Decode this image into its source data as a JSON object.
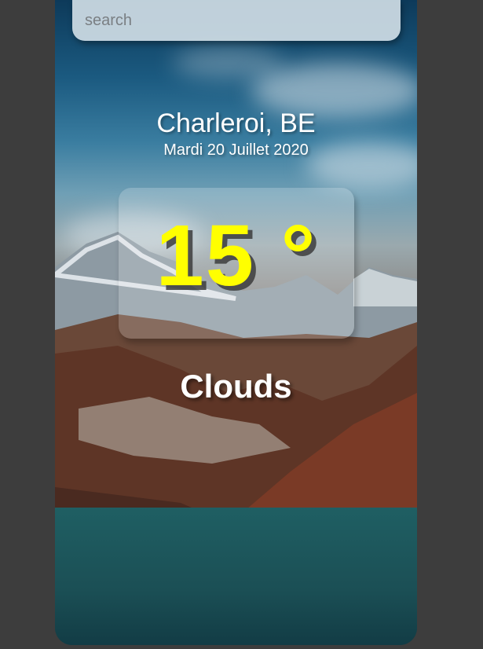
{
  "search": {
    "placeholder": "search",
    "value": ""
  },
  "location": {
    "city_country": "Charleroi, BE",
    "date": "Mardi 20 Juillet 2020"
  },
  "weather": {
    "temperature": "15 °",
    "condition": "Clouds"
  },
  "colors": {
    "page_background": "#3d3d3d",
    "temperature_text": "#ffff00",
    "text": "#ffffff",
    "search_background": "#cddce4"
  },
  "background": {
    "subject": "mountain landscape with lake and cloudy sky"
  }
}
